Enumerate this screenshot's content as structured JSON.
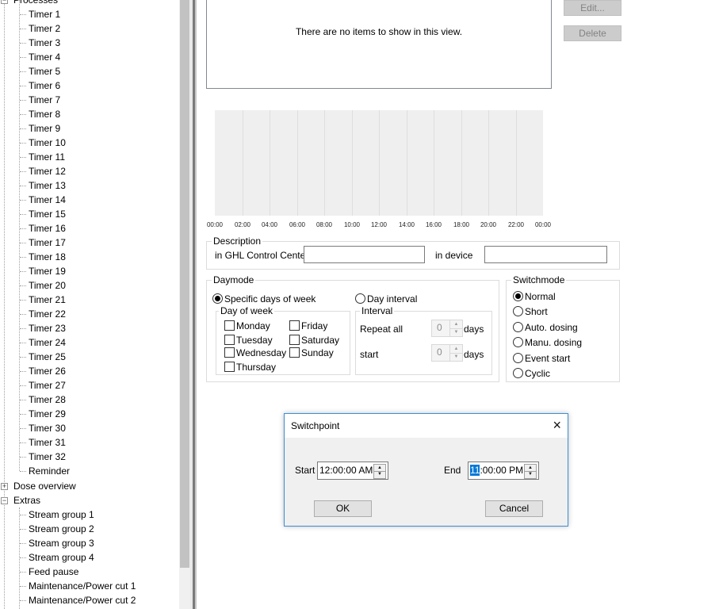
{
  "tree": {
    "processes_label": "Processes",
    "timers": [
      "Timer 1",
      "Timer 2",
      "Timer 3",
      "Timer 4",
      "Timer 5",
      "Timer 6",
      "Timer 7",
      "Timer 8",
      "Timer 9",
      "Timer 10",
      "Timer 11",
      "Timer 12",
      "Timer 13",
      "Timer 14",
      "Timer 15",
      "Timer 16",
      "Timer 17",
      "Timer 18",
      "Timer 19",
      "Timer 20",
      "Timer 21",
      "Timer 22",
      "Timer 23",
      "Timer 24",
      "Timer 25",
      "Timer 26",
      "Timer 27",
      "Timer 28",
      "Timer 29",
      "Timer 30",
      "Timer 31",
      "Timer 32",
      "Reminder"
    ],
    "dose_overview_label": "Dose overview",
    "extras_label": "Extras",
    "extras": [
      "Stream group 1",
      "Stream group 2",
      "Stream group 3",
      "Stream group 4",
      "Feed pause",
      "Maintenance/Power cut 1",
      "Maintenance/Power cut 2"
    ]
  },
  "list": {
    "empty_text": "There are no items to show in this view."
  },
  "buttons": {
    "edit": "Edit...",
    "delete": "Delete"
  },
  "timeline": {
    "ticks": [
      "00:00",
      "02:00",
      "04:00",
      "06:00",
      "08:00",
      "10:00",
      "12:00",
      "14:00",
      "16:00",
      "18:00",
      "20:00",
      "22:00",
      "00:00"
    ]
  },
  "description": {
    "title": "Description",
    "ghl_label": "in GHL Control Center",
    "ghl_value": "",
    "device_label": "in device",
    "device_value": ""
  },
  "daymode": {
    "title": "Daymode",
    "specific_label": "Specific days of week",
    "interval_label": "Day interval",
    "day_of_week_title": "Day of week",
    "days": {
      "monday": "Monday",
      "tuesday": "Tuesday",
      "wednesday": "Wednesday",
      "thursday": "Thursday",
      "friday": "Friday",
      "saturday": "Saturday",
      "sunday": "Sunday"
    },
    "interval_title": "Interval",
    "repeat_label": "Repeat all",
    "repeat_value": "0",
    "start_label": "start",
    "start_value": "0",
    "unit": "days"
  },
  "switchmode": {
    "title": "Switchmode",
    "options": [
      "Normal",
      "Short",
      "Auto. dosing",
      "Manu. dosing",
      "Event start",
      "Cyclic"
    ]
  },
  "dialog": {
    "title": "Switchpoint",
    "close_icon": "×",
    "start_label": "Start",
    "start_value": "12:00:00 AM",
    "end_label": "End",
    "end_selected": "11",
    "end_rest": ":00:00 PM",
    "ok": "OK",
    "cancel": "Cancel"
  },
  "icons": {
    "expanded": "−",
    "collapsed": "+",
    "spin_up": "▲",
    "spin_down": "▼"
  },
  "colors": {
    "accent": "#0078d7",
    "dialog_border": "#3c8fd5",
    "timeline_bg": "#efefef"
  }
}
